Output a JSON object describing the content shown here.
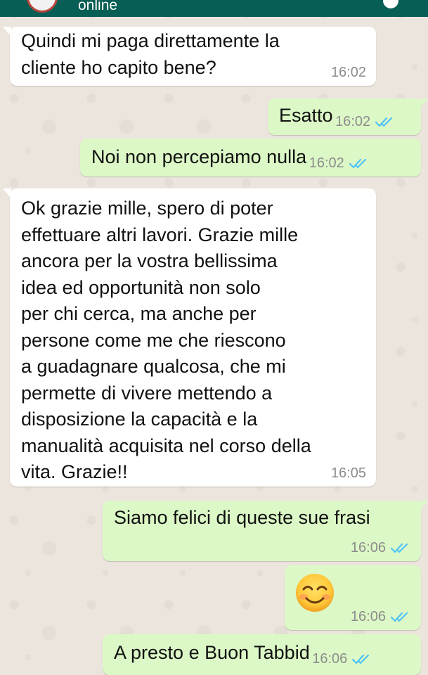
{
  "header": {
    "status": "online"
  },
  "messages": [
    {
      "direction": "in",
      "text": "Quindi mi paga direttamente la\ncliente  ho capito bene?",
      "time": "16:02"
    },
    {
      "direction": "out",
      "text": "Esatto",
      "time": "16:02",
      "read": true
    },
    {
      "direction": "out",
      "text": "Noi non percepiamo nulla",
      "time": "16:02",
      "read": true
    },
    {
      "direction": "in",
      "text": "Ok grazie mille, spero di poter\neffettuare altri lavori. Grazie mille\nancora per la vostra bellissima\nidea ed opportunità non solo\nper chi cerca, ma anche per\npersone come me  che riescono\na guadagnare qualcosa, che mi\npermette di vivere mettendo a\ndisposizione la capacità e la\nmanualità acquisita nel corso della\nvita. Grazie!!",
      "time": "16:05"
    },
    {
      "direction": "out",
      "text": "Siamo felici di queste sue frasi",
      "time": "16:06",
      "read": true
    },
    {
      "direction": "out",
      "emoji": "smiling-face-emoji",
      "time": "16:06",
      "read": true
    },
    {
      "direction": "out",
      "text": "A presto e Buon Tabbid",
      "time": "16:06",
      "read": true
    }
  ],
  "colors": {
    "header": "#075e54",
    "incoming_bubble": "#ffffff",
    "outgoing_bubble": "#dcf8c6",
    "read_ticks": "#4fc3f7",
    "wallpaper": "#ece5dd"
  }
}
